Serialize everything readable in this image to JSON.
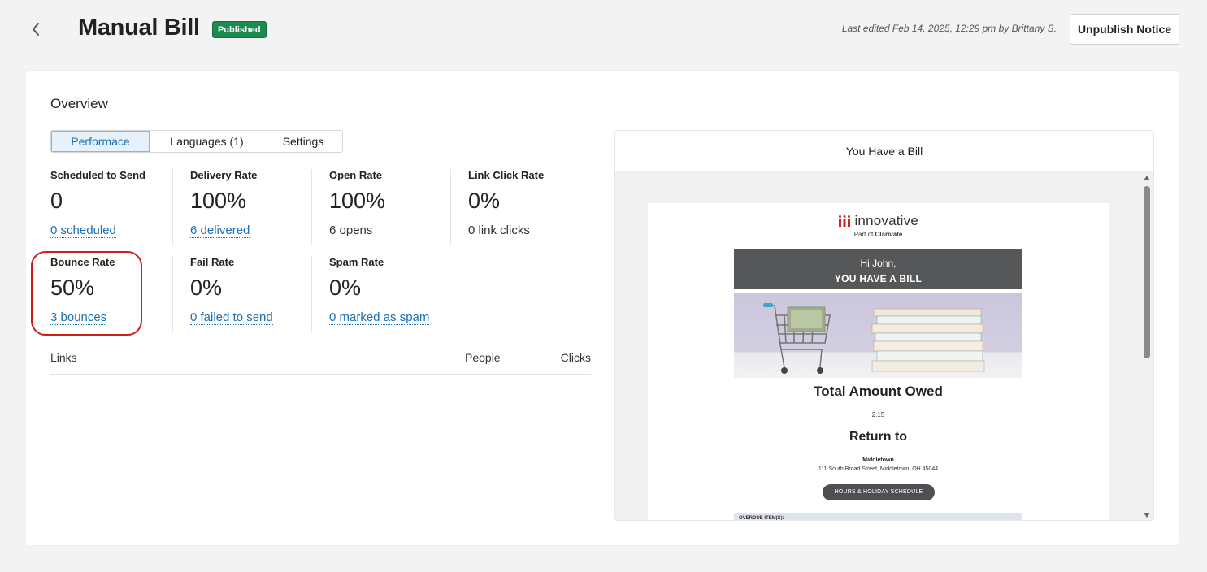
{
  "header": {
    "title": "Manual Bill",
    "status": "Published",
    "last_edited": "Last edited Feb 14, 2025, 12:29 pm by Brittany  S.",
    "unpublish_label": "Unpublish Notice"
  },
  "overview": {
    "title": "Overview",
    "tabs": [
      {
        "label": "Performace",
        "active": true
      },
      {
        "label": "Languages (1)",
        "active": false
      },
      {
        "label": "Settings",
        "active": false
      }
    ],
    "metrics": [
      {
        "label": "Scheduled to Send",
        "value": "0",
        "sub": "0 scheduled",
        "sub_is_link": true
      },
      {
        "label": "Delivery Rate",
        "value": "100%",
        "sub": "6 delivered",
        "sub_is_link": true
      },
      {
        "label": "Open Rate",
        "value": "100%",
        "sub": "6 opens",
        "sub_is_link": false
      },
      {
        "label": "Link Click Rate",
        "value": "0%",
        "sub": "0 link clicks",
        "sub_is_link": false
      },
      {
        "label": "Bounce Rate",
        "value": "50%",
        "sub": "3 bounces",
        "sub_is_link": true
      },
      {
        "label": "Fail Rate",
        "value": "0%",
        "sub": "0 failed to send",
        "sub_is_link": true
      },
      {
        "label": "Spam Rate",
        "value": "0%",
        "sub": "0 marked as spam",
        "sub_is_link": true
      }
    ],
    "links_table": {
      "columns": [
        "Links",
        "People",
        "Clicks"
      ]
    }
  },
  "preview": {
    "title": "You Have a Bill",
    "email": {
      "brand": "innovative",
      "brand_sub_prefix": "Part of ",
      "brand_sub_strong": "Clarivate",
      "greeting": "Hi John,",
      "headline": "YOU HAVE A BILL",
      "total_title": "Total Amount Owed",
      "total_value": "2.15",
      "return_title": "Return to",
      "branch_name": "Middletown",
      "branch_address": "111 South Broad Street, Middletown, OH 45044",
      "hours_button": "HOURS & HOLIDAY SCHEDULE",
      "overdue_label": "OVERDUE ITEM(S):"
    }
  },
  "colors": {
    "accent_link": "#1a6fb5",
    "badge_green": "#1d8a4f",
    "highlight_red": "#d11b1b",
    "banner_gray": "#555759",
    "brand_red": "#c8242b"
  }
}
